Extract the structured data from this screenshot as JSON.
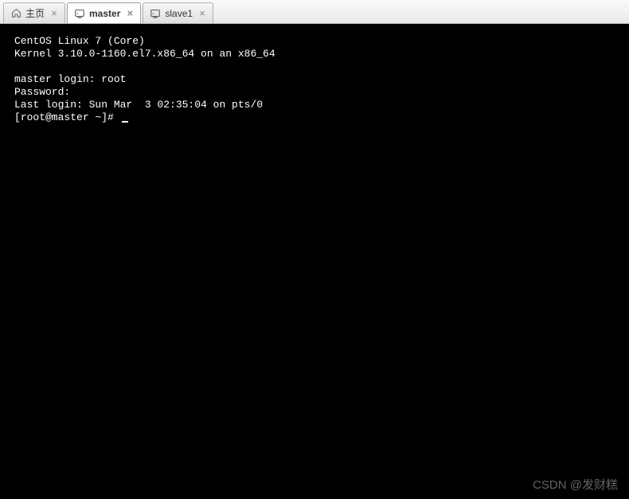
{
  "tabs": [
    {
      "label": "主页",
      "icon": "home-icon",
      "active": false
    },
    {
      "label": "master",
      "icon": "vm-icon",
      "active": true
    },
    {
      "label": "slave1",
      "icon": "vm-icon",
      "active": false
    }
  ],
  "terminal": {
    "os_line": "CentOS Linux 7 (Core)",
    "kernel_line": "Kernel 3.10.0-1160.el7.x86_64 on an x86_64",
    "login_prompt": "master login: root",
    "password_prompt": "Password:",
    "last_login": "Last login: Sun Mar  3 02:35:04 on pts/0",
    "prompt": "[root@master ~]# "
  },
  "watermark": "CSDN @发财糕"
}
